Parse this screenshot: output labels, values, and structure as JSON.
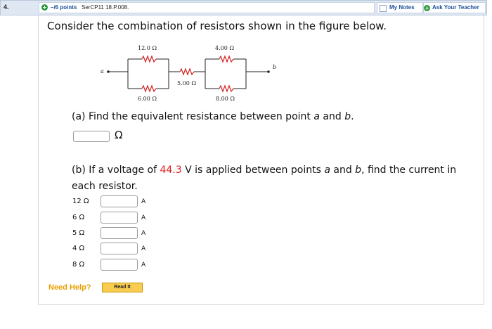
{
  "header": {
    "question_number": "4.",
    "points": "–/6 points",
    "problem_code": "SerCP11 18.P.008.",
    "my_notes_label": "My Notes",
    "ask_teacher_label": "Ask Your Teacher"
  },
  "question": {
    "prompt": "Consider the combination of resistors shown in the figure below.",
    "figure": {
      "point_a": "a",
      "point_b": "b",
      "r1_label": "12.0 Ω",
      "r2_label": "6.00 Ω",
      "r3_label": "5.00 Ω",
      "r4_label": "4.00 Ω",
      "r5_label": "8.00 Ω"
    },
    "part_a": {
      "text_before": "(a) Find the equivalent resistance between point ",
      "var_a": "a",
      "text_mid": " and ",
      "var_b": "b",
      "text_end": ".",
      "answer_value": "",
      "unit": "Ω"
    },
    "part_b": {
      "text_before": "(b) If a voltage of ",
      "voltage": "44.3",
      "text_mid1": " V is applied between points ",
      "var_a": "a",
      "text_mid2": " and ",
      "var_b": "b",
      "text_end": ", find the current in each resistor.",
      "rows": [
        {
          "label": "12 Ω",
          "value": "",
          "unit": "A"
        },
        {
          "label": "6 Ω",
          "value": "",
          "unit": "A"
        },
        {
          "label": "5 Ω",
          "value": "",
          "unit": "A"
        },
        {
          "label": "4 Ω",
          "value": "",
          "unit": "A"
        },
        {
          "label": "8 Ω",
          "value": "",
          "unit": "A"
        }
      ]
    }
  },
  "help": {
    "need_help_label": "Need Help?",
    "read_it_label": "Read It"
  },
  "colors": {
    "link_blue": "#1b4f9c",
    "plus_green": "#2a9a3e",
    "voltage_red": "#e02020",
    "help_orange": "#e8a000",
    "button_yellow": "#f8cc50"
  }
}
